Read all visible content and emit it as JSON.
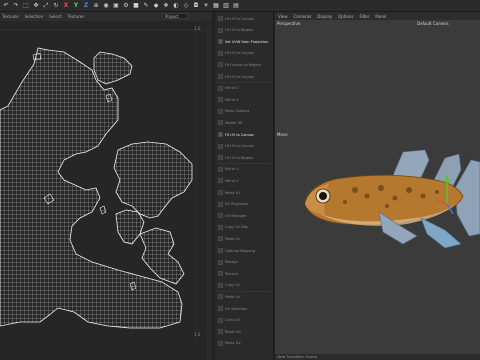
{
  "toolbar": {
    "icons": [
      "undo-icon",
      "redo-icon",
      "select-icon",
      "move-icon",
      "scale-icon",
      "rotate-icon",
      "x-axis",
      "y-axis",
      "z-axis",
      "coord-icon",
      "render-icon",
      "render-view-icon",
      "render-settings-icon",
      "cube-icon",
      "pen-icon",
      "subdivide-icon",
      "clone-icon",
      "deformer-icon",
      "scene-icon",
      "camera-icon",
      "light-icon",
      "grid-icon",
      "layout-icon",
      "extra-icon"
    ],
    "x_label": "X",
    "y_label": "Y",
    "z_label": "Z"
  },
  "uv_editor": {
    "menu": [
      "Textures",
      "Selection",
      "Select",
      "Textures"
    ],
    "dropdown": "Project",
    "ticks": {
      "top_right": "1.0",
      "bottom_right": "1.0"
    }
  },
  "commands": {
    "items": [
      {
        "label": "Fit UV to Canvas",
        "active": false
      },
      {
        "label": "Fit UV to Region",
        "active": false
      },
      {
        "label": "Set UVW from Projection",
        "active": true
      },
      {
        "label": "Fit UV to Canvas",
        "active": false
      },
      {
        "label": "Fit Canvas to Region",
        "active": false
      },
      {
        "label": "Fit UV to Canvas",
        "active": false
      },
      {
        "label": "Mirror U",
        "active": false
      },
      {
        "label": "Mirror V",
        "active": false
      },
      {
        "label": "Relax Options",
        "active": false
      },
      {
        "label": "Rotate 90",
        "active": false
      },
      {
        "label": "Fit UV to Canvas",
        "active": true
      },
      {
        "label": "Fit UV to Canvas",
        "active": false
      },
      {
        "label": "Fit UV to Region",
        "active": false
      },
      {
        "label": "Mirror U",
        "active": false
      },
      {
        "label": "Mirror V",
        "active": false
      },
      {
        "label": "Relax UV",
        "active": false
      },
      {
        "label": "UV Projection",
        "active": false
      },
      {
        "label": "UV Manager",
        "active": false
      },
      {
        "label": "Copy UV Map",
        "active": false
      },
      {
        "label": "Paste UV",
        "active": false
      },
      {
        "label": "Optimal Mapping",
        "active": false
      },
      {
        "label": "Realign",
        "active": false
      },
      {
        "label": "Terrace",
        "active": false
      },
      {
        "label": "Copy UV",
        "active": false
      },
      {
        "label": "Paste UV",
        "active": false
      },
      {
        "label": "UV Selection",
        "active": false
      },
      {
        "label": "Clear UV",
        "active": false
      },
      {
        "label": "Reset UV",
        "active": false
      },
      {
        "label": "Relax UV",
        "active": false
      }
    ]
  },
  "viewport": {
    "menu": [
      "View",
      "Cameras",
      "Display",
      "Options",
      "Filter",
      "Panel"
    ],
    "perspective": "Perspective",
    "camera": "Default Camera",
    "move_label": "Move",
    "status": "View Transform: Scene"
  }
}
